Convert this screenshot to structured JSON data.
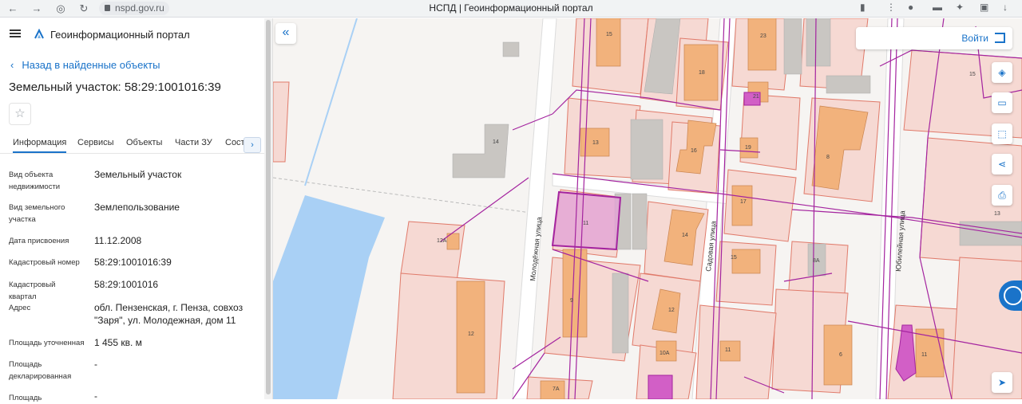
{
  "browser": {
    "url": "nspd.gov.ru",
    "tab_title": "НСПД | Геоинформационный портал"
  },
  "app": {
    "title": "Геоинформационный портал",
    "back_label": "Назад в найденные объекты",
    "object_title": "Земельный участок: 58:29:1001016:39"
  },
  "tabs": [
    "Информация",
    "Сервисы",
    "Объекты",
    "Части ЗУ",
    "Соста"
  ],
  "info": [
    {
      "label": "Вид объекта недвижимости",
      "value": "Земельный участок"
    },
    {
      "label": "Вид земельного участка",
      "value": "Землепользование"
    },
    {
      "label": "Дата присвоения",
      "value": "11.12.2008"
    },
    {
      "label": "Кадастровый номер",
      "value": "58:29:1001016:39"
    },
    {
      "label": "Кадастровый квартал",
      "value": "58:29:1001016"
    },
    {
      "label": "Адрес",
      "value": "обл. Пензенская, г. Пенза, совхоз \"Заря\", ул. Молодежная, дом 11"
    },
    {
      "label": "Площадь уточненная",
      "value": "1 455 кв. м"
    },
    {
      "label": "Площадь декларированная",
      "value": "-"
    },
    {
      "label": "Площадь",
      "value": "-"
    }
  ],
  "map": {
    "login_label": "Войти",
    "streets": [
      "Молодёжная улица",
      "Садовая улица",
      "Юбилейная улица"
    ],
    "house_numbers": [
      "15",
      "23",
      "18",
      "21",
      "15",
      "14",
      "13",
      "16",
      "19",
      "8",
      "12А",
      "11",
      "14",
      "17",
      "13",
      "9",
      "12",
      "15",
      "8А",
      "12",
      "11",
      "6",
      "11",
      "12",
      "10А",
      "7А"
    ],
    "colors": {
      "parcel_fill": "#f6d9d3",
      "parcel_stroke": "#e07a6a",
      "building": "#f2b27c",
      "selected": "#e3a3d6",
      "utility": "#a4249f",
      "water": "#a9d0f5"
    }
  }
}
